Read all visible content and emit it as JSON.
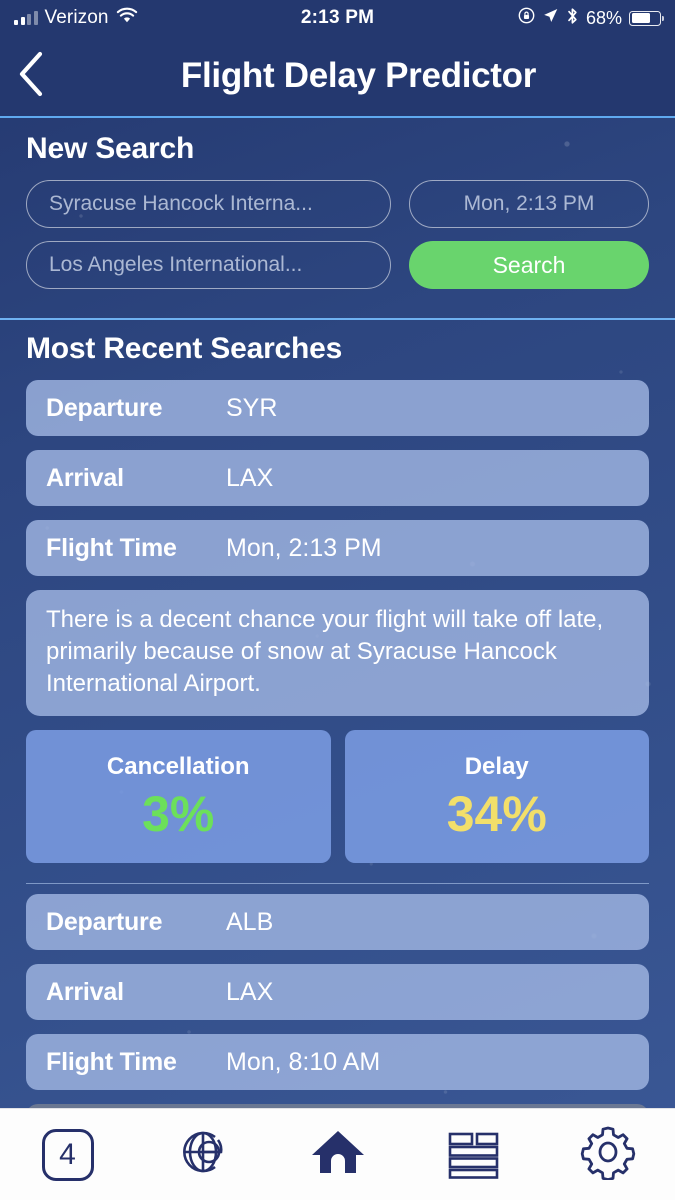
{
  "status_bar": {
    "carrier": "Verizon",
    "time": "2:13 PM",
    "battery_percent": "68%",
    "battery_level": 68,
    "icons": [
      "signal-bars-icon",
      "wifi-icon",
      "rotation-lock-icon",
      "location-arrow-icon",
      "bluetooth-icon",
      "battery-icon"
    ]
  },
  "navbar": {
    "title": "Flight Delay Predictor",
    "back_icon": "back-chevron-icon"
  },
  "new_search": {
    "title": "New Search",
    "origin_value": "Syracuse Hancock Interna...",
    "destination_value": "Los Angeles International...",
    "date_value": "Mon, 2:13 PM",
    "search_label": "Search"
  },
  "recent": {
    "title": "Most Recent Searches",
    "labels": {
      "departure": "Departure",
      "arrival": "Arrival",
      "flight_time": "Flight Time",
      "cancellation": "Cancellation",
      "delay": "Delay"
    },
    "searches": [
      {
        "departure": "SYR",
        "arrival": "LAX",
        "flight_time": "Mon, 2:13 PM",
        "message": "There is a decent chance your flight will take off late, primarily because of snow at Syracuse Hancock International Airport.",
        "cancellation": "3%",
        "delay": "34%"
      },
      {
        "departure": "ALB",
        "arrival": "LAX",
        "flight_time": "Mon, 8:10 AM"
      }
    ]
  },
  "tabbar": {
    "items": [
      {
        "name": "tab-count",
        "label": "4",
        "icon": "count-badge-icon"
      },
      {
        "name": "tab-globe",
        "label": "",
        "icon": "globe-logo-icon"
      },
      {
        "name": "tab-home",
        "label": "",
        "icon": "home-icon"
      },
      {
        "name": "tab-list",
        "label": "",
        "icon": "list-layout-icon"
      },
      {
        "name": "tab-settings",
        "label": "",
        "icon": "gear-icon"
      }
    ]
  },
  "colors": {
    "background_navy": "#2c4680",
    "header_navy": "#24386f",
    "divider_blue": "#6fb2f2",
    "card_light_blue": "#a2b8e4",
    "stat_card_blue": "#7d9ee4",
    "accent_green": "#69d46d",
    "cancellation_green": "#6ce05a",
    "delay_yellow": "#f2df6a",
    "tab_icon_navy": "#26306a"
  }
}
